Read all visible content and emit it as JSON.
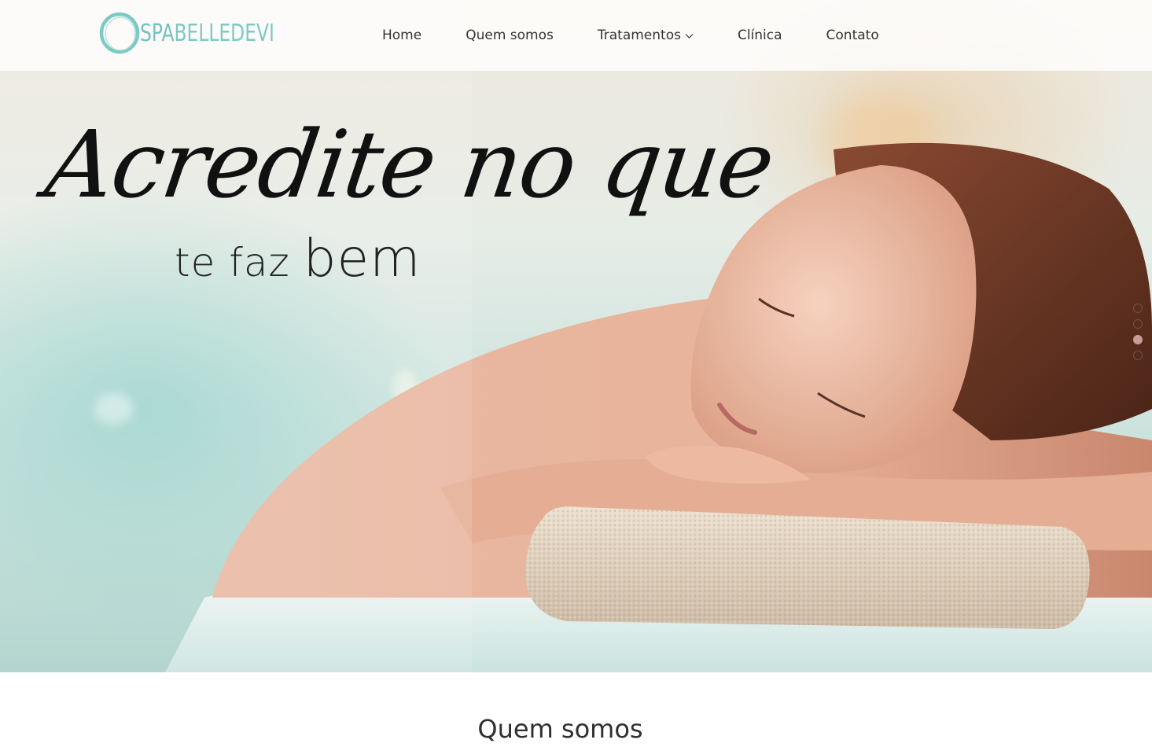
{
  "brand": {
    "name_part1": "SPA",
    "name_part2": "BELLEDEVI",
    "ring_color": "#7dc9c5"
  },
  "nav": {
    "items": [
      {
        "label": "Home"
      },
      {
        "label": "Quem somos"
      },
      {
        "label": "Tratamentos",
        "has_dropdown": true,
        "icon": "chevron-down-icon"
      },
      {
        "label": "Clínica"
      },
      {
        "label": "Contato"
      }
    ]
  },
  "hero": {
    "headline_script": "Acredite no que",
    "headline_sub_a": "te faz",
    "headline_sub_b": "bem",
    "slider": {
      "total_slides": 4,
      "active_index": 3,
      "active_color": "#c79e97"
    }
  },
  "section": {
    "title": "Quem somos"
  }
}
